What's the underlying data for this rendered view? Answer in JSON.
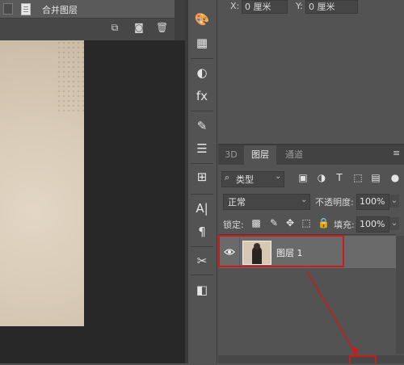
{
  "history": {
    "item_label": "合并图层",
    "buttons": [
      "new-snapshot-icon",
      "camera-icon",
      "trash-icon"
    ]
  },
  "properties": {
    "x_label": "X:",
    "x_value": "0 厘米",
    "y_label": "Y:",
    "y_value": "0 厘米"
  },
  "toolstrip": {
    "icons": [
      "palette-icon",
      "grid-icon",
      "adjustment-icon",
      "style-icon",
      "brush-icon",
      "brush-settings-icon",
      "clone-source-icon",
      "character-icon",
      "paragraph-icon",
      "tool-presets-icon",
      "layer-comps-icon"
    ]
  },
  "layers_panel": {
    "tabs": [
      {
        "label": "3D",
        "active": false
      },
      {
        "label": "图层",
        "active": true
      },
      {
        "label": "通道",
        "active": false
      }
    ],
    "filter_kind": "类型",
    "blend_mode": "正常",
    "opacity_label": "不透明度:",
    "opacity_value": "100%",
    "lock_label": "锁定:",
    "fill_label": "填充:",
    "fill_value": "100%",
    "layers": [
      {
        "name": "图层 1",
        "visible": true,
        "selected": true
      }
    ]
  },
  "colors": {
    "panel_bg": "#535353",
    "canvas_bg": "#282828",
    "highlight_red": "#cf1a1a"
  }
}
